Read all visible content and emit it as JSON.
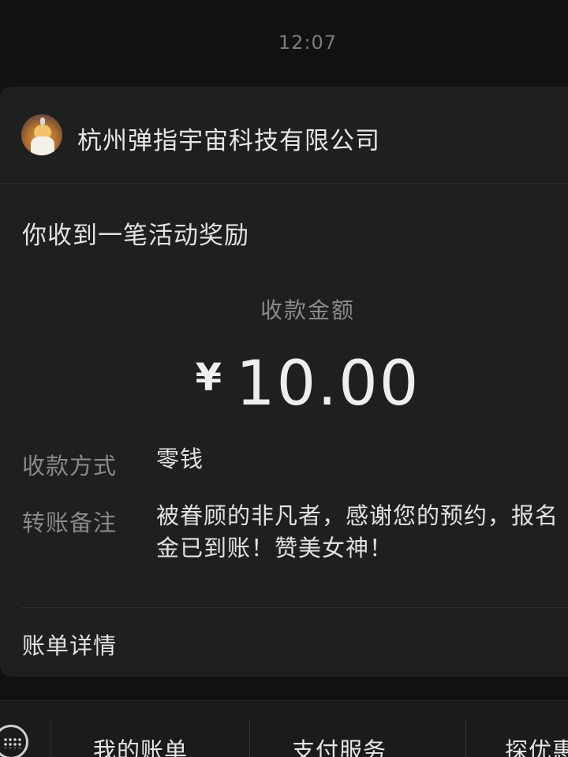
{
  "chat": {
    "timestamp": "12:07"
  },
  "card": {
    "sender_name": "杭州弹指宇宙科技有限公司",
    "title": "你收到一笔活动奖励",
    "amount_label": "收款金额",
    "currency_symbol": "¥",
    "amount": "10.00",
    "fields": [
      {
        "label": "收款方式",
        "value": "零钱"
      },
      {
        "label": "转账备注",
        "value_line1": "被眷顾的非凡者，感谢您的预约，报名",
        "value_line2": "金已到账！赞美女神！"
      }
    ],
    "footer_link": "账单详情"
  },
  "bottom_menu": {
    "icon": "keyboard-icon",
    "items": [
      {
        "label": "我的账单"
      },
      {
        "label": "支付服务"
      },
      {
        "label": "探优惠"
      }
    ]
  }
}
